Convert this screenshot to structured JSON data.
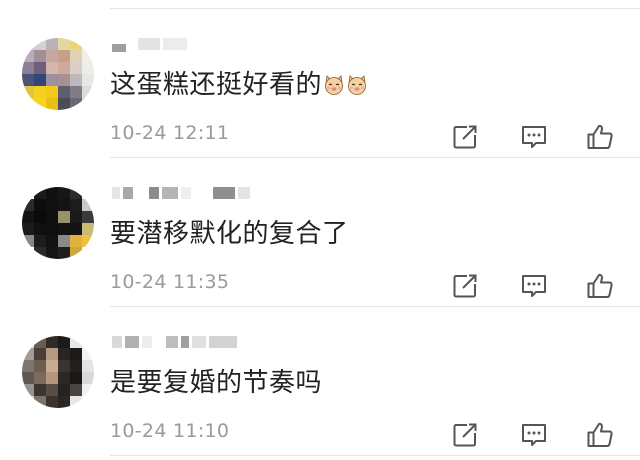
{
  "comments": [
    {
      "text": "这蛋糕还挺好看的",
      "emoji": [
        "cat-emoji",
        "cat-emoji"
      ],
      "time": "10-24 12:11"
    },
    {
      "text": "要潜移默化的复合了",
      "time": "10-24 11:35"
    },
    {
      "text": "是要复婚的节奏吗",
      "time": "10-24 11:10"
    }
  ],
  "icons": {
    "share": "share-icon",
    "reply": "comment-icon",
    "like": "thumbs-up-icon"
  },
  "colors": {
    "text": "#222222",
    "meta": "#9a9a9a",
    "icon": "#555555",
    "divider": "#e6e6e6"
  }
}
